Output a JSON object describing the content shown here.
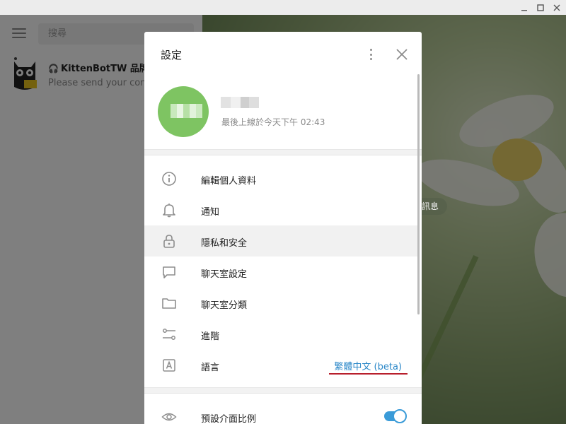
{
  "window": {
    "minimize": "—",
    "maximize": "☐",
    "close": "✕"
  },
  "sidebar": {
    "search_placeholder": "搜尋",
    "chats": [
      {
        "title": "KittenBotTW 品牌...",
        "preview": "Please send your contact",
        "badge": "bot-icon"
      }
    ]
  },
  "chat_area": {
    "pill_text": "傳訊息"
  },
  "settings": {
    "title": "設定",
    "profile": {
      "last_seen": "最後上線於今天下午 02:43"
    },
    "items": [
      {
        "label": "編輯個人資料",
        "icon": "info-icon"
      },
      {
        "label": "通知",
        "icon": "bell-icon"
      },
      {
        "label": "隱私和安全",
        "icon": "lock-icon"
      },
      {
        "label": "聊天室設定",
        "icon": "chat-bubble-icon"
      },
      {
        "label": "聊天室分類",
        "icon": "folder-icon"
      },
      {
        "label": "進階",
        "icon": "sliders-icon"
      },
      {
        "label": "語言",
        "icon": "language-icon",
        "value": "繁體中文 (beta)"
      }
    ],
    "scale": {
      "label": "預設介面比例",
      "icon": "eye-icon",
      "enabled": true
    }
  },
  "colors": {
    "accent": "#3a9bd8",
    "link": "#2a87c8",
    "avatar": "#7ec462",
    "underline": "#b81f2c"
  }
}
